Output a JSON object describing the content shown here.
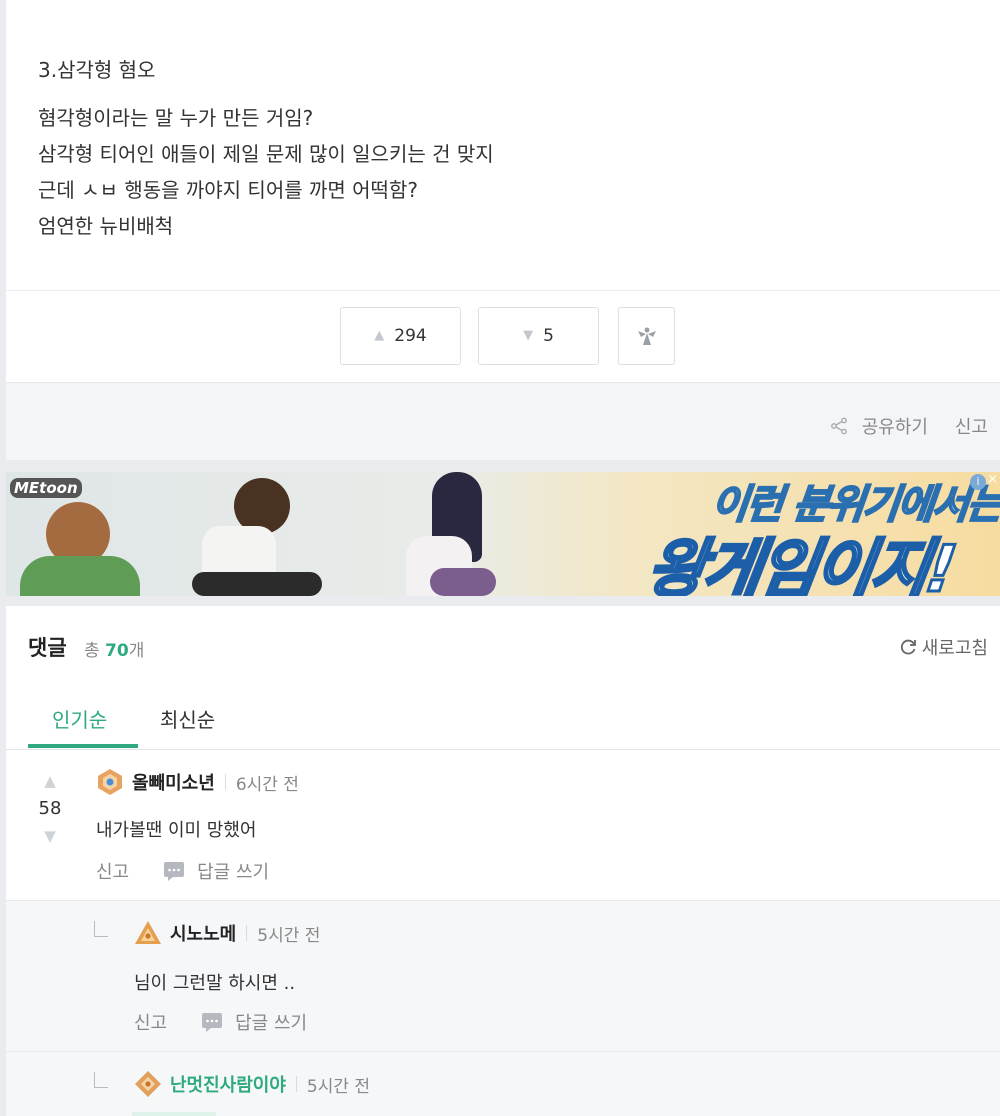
{
  "article": {
    "heading": "3.삼각형 혐오",
    "lines": [
      "혐각형이라는 말 누가 만든 거임?",
      "삼각형 티어인 애들이 제일 문제 많이 일으키는 건 맞지",
      "근데 ㅅㅂ 행동을 까야지 티어를 까면 어떡함?",
      "엄연한 뉴비배척"
    ]
  },
  "votes": {
    "up_count": "294",
    "down_count": "5",
    "up_icon": "triangle-up-icon",
    "down_icon": "triangle-down-icon",
    "angel_icon": "angel-icon"
  },
  "share_bar": {
    "share_label": "공유하기",
    "report_label": "신고",
    "share_icon": "share-icon"
  },
  "ad": {
    "logo": "MEtoon",
    "line1": "이런 분위기에서는",
    "line2": "왕게임이지!"
  },
  "comments_section": {
    "title": "댓글",
    "total_prefix": "총",
    "count": "70",
    "count_suffix": "개",
    "refresh_label": "새로고침",
    "tabs": [
      "인기순",
      "최신순"
    ],
    "active_tab": "인기순",
    "accent_color": "#2eaa7e"
  },
  "comments": [
    {
      "votes": "58",
      "nickname": "올빼미소년",
      "time": "6시간 전",
      "text": "내가볼땐 이미 망했어",
      "report_label": "신고",
      "reply_label": "답글 쓰기"
    },
    {
      "nickname": "시노노메",
      "time": "5시간 전",
      "text": "님이 그런말 하시면 ..",
      "report_label": "신고",
      "reply_label": "답글 쓰기"
    },
    {
      "nickname": "난멋진사람이야",
      "time": "5시간 전"
    }
  ]
}
